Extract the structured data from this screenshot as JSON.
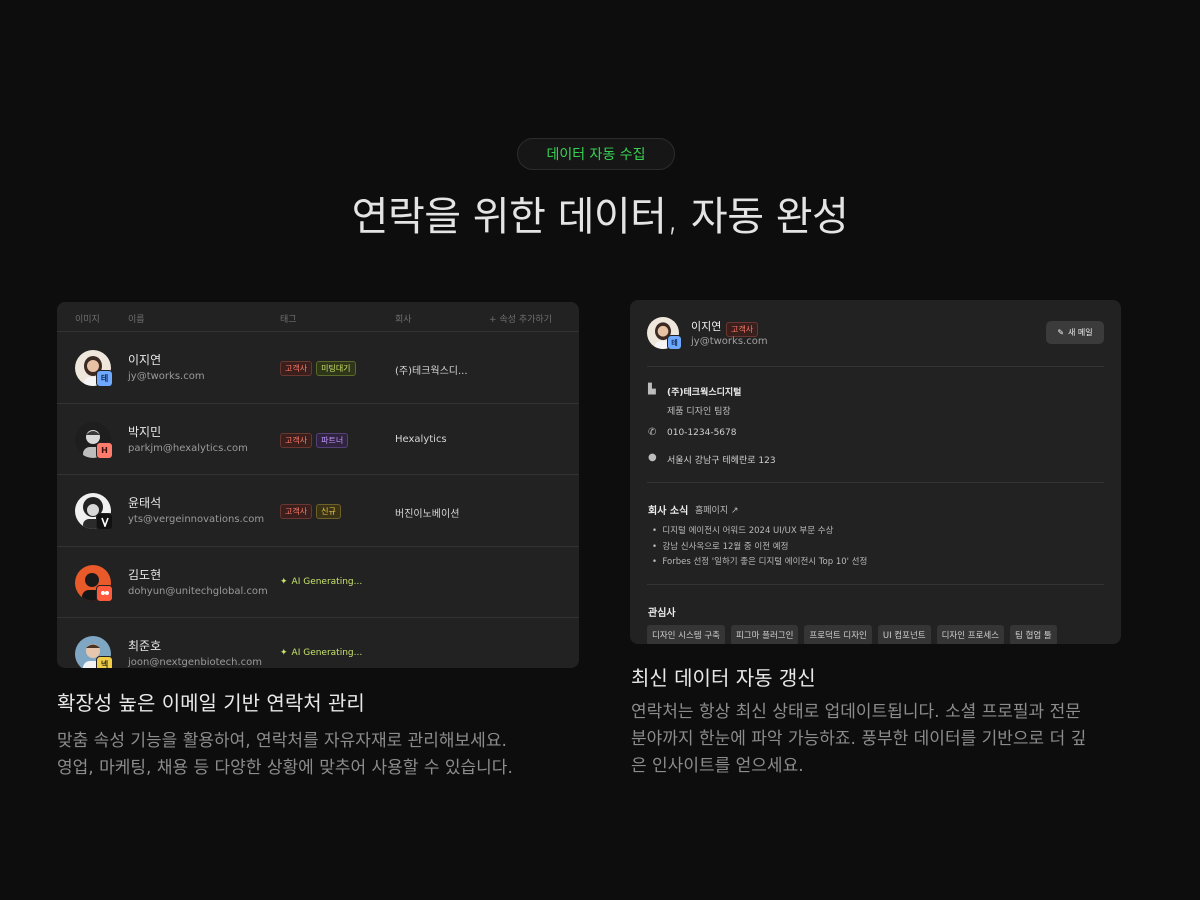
{
  "hero": {
    "pill": "데이터 자동 수집",
    "title": "연락을 위한 데이터, 자동 완성"
  },
  "table": {
    "headers": {
      "image": "이미지",
      "name": "이름",
      "tags": "태그",
      "company": "회사",
      "add": "+ 속성 추가하기"
    },
    "rows": [
      {
        "name": "이지연",
        "email": "jy@tworks.com",
        "tags": [
          "고객사",
          "미팅대기"
        ],
        "company": "(주)테크웍스디...",
        "badge": "테"
      },
      {
        "name": "박지민",
        "email": "parkjm@hexalytics.com",
        "tags": [
          "고객사",
          "파트너"
        ],
        "company": "Hexalytics",
        "badge": "H"
      },
      {
        "name": "윤태석",
        "email": "yts@vergeinnovations.com",
        "tags": [
          "고객사",
          "신규"
        ],
        "company": "버진이노베이션",
        "badge": ""
      },
      {
        "name": "김도현",
        "email": "dohyun@unitechglobal.com",
        "ai": "AI Generating...",
        "badge": ""
      },
      {
        "name": "최준호",
        "email": "joon@nextgenbiotech.com",
        "ai": "AI Generating...",
        "badge": "넥"
      }
    ]
  },
  "left_caption": {
    "title": "확장성 높은 이메일 기반 연락처 관리",
    "line1": "맞춤 속성 기능을 활용하여, 연락처를 자유자재로 관리해보세요.",
    "line2": "영업, 마케팅, 채용 등 다양한 상황에 맞추어 사용할 수 있습니다."
  },
  "profile": {
    "name": "이지연",
    "tag": "고객사",
    "email": "jy@tworks.com",
    "badge": "테",
    "button": "새 메일",
    "company": "(주)테크웍스디지털",
    "role": "제품 디자인 팀장",
    "phone": "010-1234-5678",
    "address": "서울시 강남구 테헤란로 123",
    "news_title": "회사 소식",
    "news_link": "홈페이지 ↗",
    "news": [
      "디지털 에이전시 어워드 2024 UI/UX 부문 수상",
      "강남 신사옥으로 12월 중 이전 예정",
      "Forbes 선정 '일하기 좋은 디지털 에이전시 Top 10' 선정"
    ],
    "interests_title": "관심사",
    "interests": [
      "디자인 시스템 구축",
      "피그마 플러그인",
      "프로덕트 디자인",
      "UI 컴포넌트",
      "디자인 프로세스",
      "팀 협업 툴"
    ]
  },
  "right_caption": {
    "title": "최신 데이터 자동 갱신",
    "line1": "연락처는 항상 최신 상태로 업데이트됩니다. 소셜 프로필과 전문",
    "line2": "분야까지 한눈에 파악 가능하죠. 풍부한 데이터를 기반으로 더 깊",
    "line3": "은 인사이트를 얻으세요."
  },
  "colors": {
    "accent": "#39d353",
    "background": "#0d0d0d",
    "card": "#222222"
  }
}
